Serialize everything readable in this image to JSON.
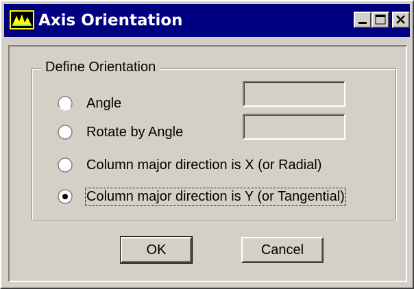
{
  "window": {
    "title": "Axis Orientation",
    "controls": {
      "minimize": "minimize-icon",
      "maximize": "maximize-icon",
      "close": "close-icon"
    },
    "title_color": "#000080"
  },
  "group": {
    "legend": "Define Orientation",
    "options": [
      {
        "label": "Angle",
        "selected": false
      },
      {
        "label": "Rotate by Angle",
        "selected": false
      },
      {
        "label": "Column major direction is X  (or Radial)",
        "selected": false
      },
      {
        "label": "Column major direction is Y  (or Tangential)",
        "selected": true
      }
    ],
    "angle_value": "",
    "rotate_value": ""
  },
  "buttons": {
    "ok": "OK",
    "cancel": "Cancel"
  }
}
